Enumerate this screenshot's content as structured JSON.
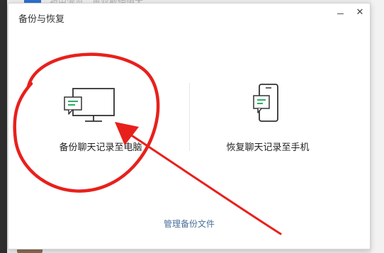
{
  "background": {
    "chat_preview": "祖由灌览，重业截使隙太"
  },
  "dialog": {
    "title": "备份与恢复",
    "minimize_label": "",
    "close_label": "✕",
    "options": [
      {
        "label": "备份聊天记录至电脑",
        "icon": "monitor-chat-icon"
      },
      {
        "label": "恢复聊天记录至手机",
        "icon": "phone-chat-icon"
      }
    ],
    "manage_link": "管理备份文件"
  },
  "colors": {
    "annotation": "#e8201c",
    "chat_bubble": "#2aae67",
    "link": "#4a6f99"
  }
}
